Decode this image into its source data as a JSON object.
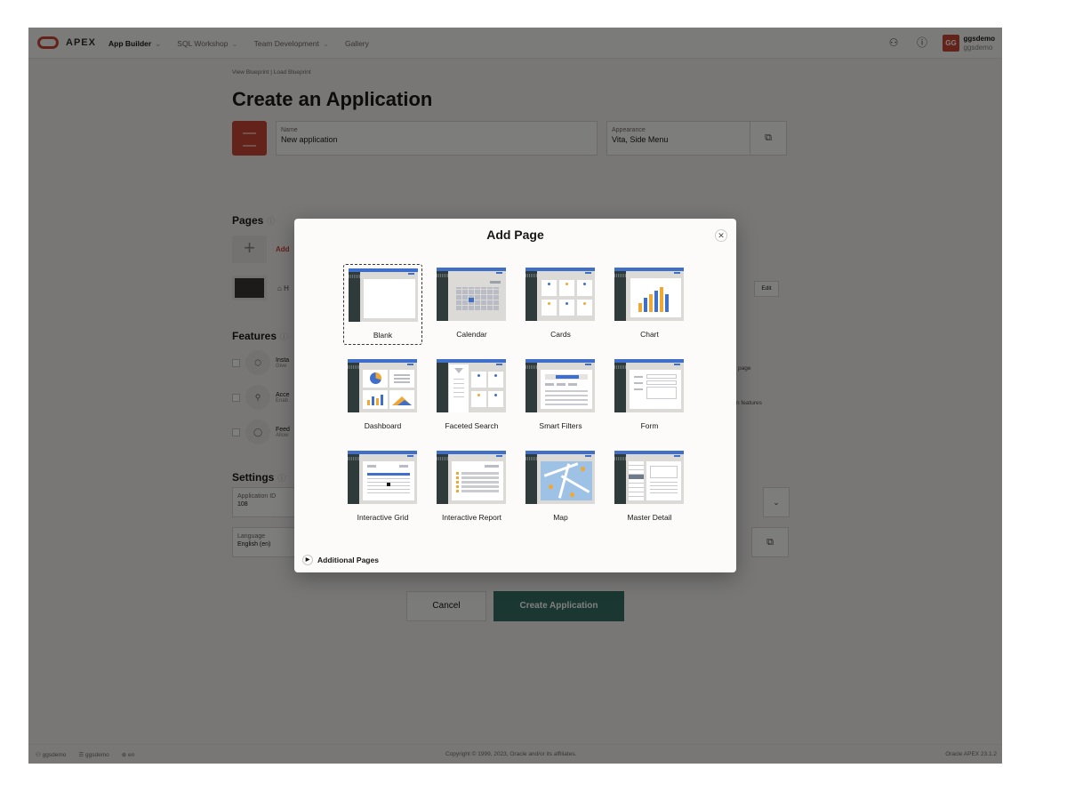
{
  "topbar": {
    "brand": "APEX",
    "nav": [
      {
        "label": "App Builder",
        "active": true
      },
      {
        "label": "SQL Workshop",
        "active": false
      },
      {
        "label": "Team Development",
        "active": false
      },
      {
        "label": "Gallery",
        "active": false
      }
    ],
    "avatar_initials": "GG",
    "user": "ggsdemo",
    "workspace": "ggsdemo"
  },
  "page": {
    "breadcrumb": "View Blueprint  |  Load Blueprint",
    "title": "Create an Application",
    "name_label": "Name",
    "name_value": "New application",
    "appearance_label": "Appearance",
    "appearance_value": "Vita, Side Menu",
    "pages_heading": "Pages",
    "add_label": "Add",
    "home_label": "H",
    "edit_label": "Edit",
    "features_heading": "Features",
    "features": [
      {
        "title": "Insta",
        "sub": "Give"
      },
      {
        "title": "Acce",
        "sub": "Enab"
      },
      {
        "title": "Feed",
        "sub": "Allow"
      }
    ],
    "feature_right_1": "page",
    "feature_right_2": "n features",
    "settings_heading": "Settings",
    "app_id_label": "Application ID",
    "app_id_value": "108",
    "language_label": "Language",
    "language_value": "English (en)",
    "cancel_label": "Cancel",
    "create_label": "Create Application"
  },
  "footer": {
    "user": "ggsdemo",
    "workspace": "ggsdemo",
    "lang": "en",
    "copyright": "Copyright © 1999, 2023, Oracle and/or its affiliates.",
    "version": "Oracle APEX 23.1.2"
  },
  "modal": {
    "title": "Add Page",
    "tiles": [
      {
        "label": "Blank",
        "icon": "blank-page-icon"
      },
      {
        "label": "Calendar",
        "icon": "calendar-page-icon"
      },
      {
        "label": "Cards",
        "icon": "cards-page-icon"
      },
      {
        "label": "Chart",
        "icon": "chart-page-icon"
      },
      {
        "label": "Dashboard",
        "icon": "dashboard-page-icon"
      },
      {
        "label": "Faceted Search",
        "icon": "faceted-search-page-icon"
      },
      {
        "label": "Smart Filters",
        "icon": "smart-filters-page-icon"
      },
      {
        "label": "Form",
        "icon": "form-page-icon"
      },
      {
        "label": "Interactive Grid",
        "icon": "interactive-grid-page-icon"
      },
      {
        "label": "Interactive Report",
        "icon": "interactive-report-page-icon"
      },
      {
        "label": "Map",
        "icon": "map-page-icon"
      },
      {
        "label": "Master Detail",
        "icon": "master-detail-page-icon"
      }
    ],
    "selected": "Blank",
    "additional_pages_label": "Additional Pages"
  },
  "colors": {
    "accent": "#c74634",
    "thumb_bar": "#3f6fc8",
    "create_button": "#356e64"
  }
}
